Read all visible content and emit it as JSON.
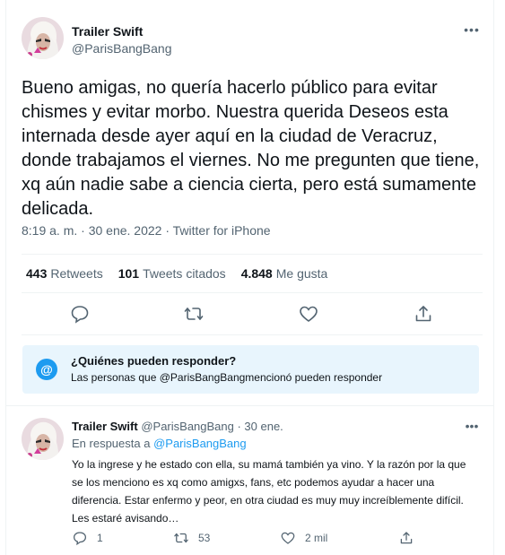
{
  "main_tweet": {
    "author_name": "Trailer Swift",
    "author_handle": "@ParisBangBang",
    "text": "Bueno amigas, no quería hacerlo público para evitar chismes y evitar morbo. Nuestra querida Deseos esta internada desde ayer aquí en la ciudad de Veracruz, donde trabajamos el viernes. No me pregunten que tiene, xq aún nadie sabe a ciencia cierta, pero está sumamente delicada.",
    "timestamp": "8:19 a. m. · 30 ene. 2022 · Twitter for iPhone",
    "more_glyph": "•••",
    "stats": {
      "retweets_count": "443",
      "retweets_label": "Retweets",
      "quotes_count": "101",
      "quotes_label": "Tweets citados",
      "likes_count": "4.848",
      "likes_label": "Me gusta"
    }
  },
  "reply_restriction": {
    "icon": "@",
    "title": "¿Quiénes pueden responder?",
    "subtitle": "Las personas que @ParisBangBangmencionó pueden responder"
  },
  "reply_tweet": {
    "author_name": "Trailer Swift",
    "author_handle": "@ParisBangBang · 30 ene.",
    "in_reply_prefix": "En respuesta a",
    "in_reply_handle": "@ParisBangBang",
    "text": "Yo la ingrese y he estado con ella, su mamá también ya vino. Y la razón por la que se los menciono es xq como amigxs, fans, etc podemos ayudar a hacer una diferencia. Estar enfermo y peor, en otra ciudad es muy muy increíblemente difícil. Les estaré avisando…",
    "more_glyph": "•••",
    "reply_count": "1",
    "retweet_count": "53",
    "like_count": "2 mil"
  },
  "icons": [
    "reply-icon",
    "retweet-icon",
    "like-icon",
    "share-icon",
    "more-icon",
    "at-icon",
    "avatar"
  ],
  "colors": {
    "accent": "#1d9bf0",
    "secondary_text": "#536471",
    "reply_box_bg": "#e8f5fd",
    "divider": "#eff3f4"
  }
}
